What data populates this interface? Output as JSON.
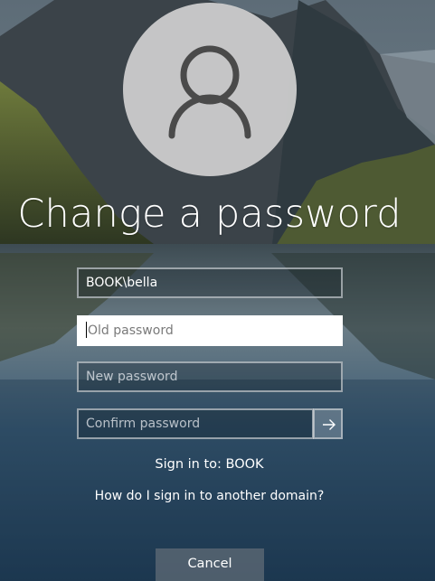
{
  "page": {
    "title": "Change a password"
  },
  "fields": {
    "username": {
      "value": "BOOK\\bella"
    },
    "old_password": {
      "placeholder": "Old password"
    },
    "new_password": {
      "placeholder": "New password"
    },
    "confirm_password": {
      "placeholder": "Confirm password"
    }
  },
  "submit": {
    "icon": "arrow-right-icon"
  },
  "sign_in_to": "Sign in to: BOOK",
  "domain_link": "How do I sign in to another domain?",
  "cancel_label": "Cancel",
  "avatar": {
    "icon": "user-icon"
  },
  "colors": {
    "avatar_bg": "#d0d0d0",
    "avatar_icon": "#4a4a4a",
    "input_active_bg": "#ffffff"
  }
}
